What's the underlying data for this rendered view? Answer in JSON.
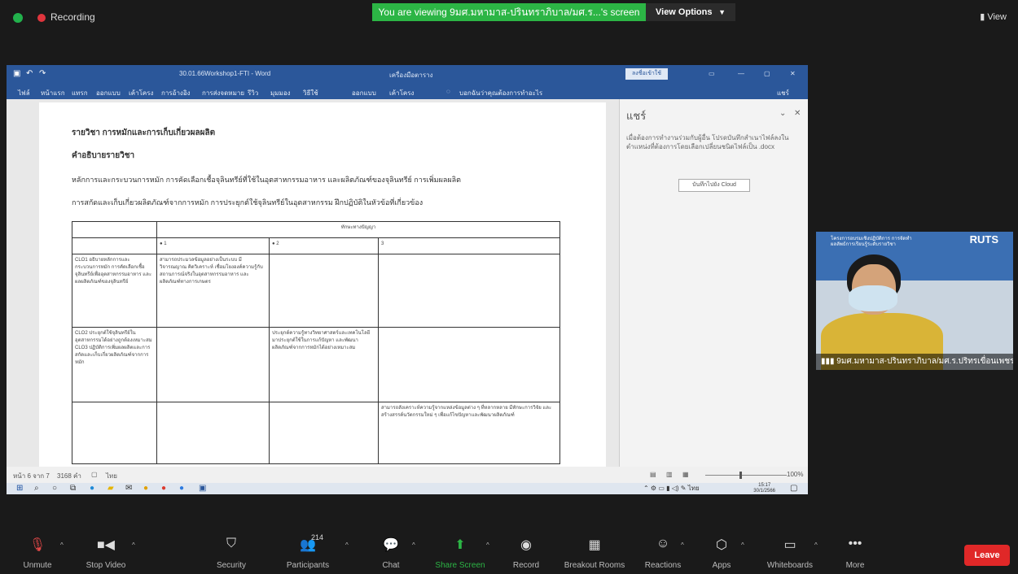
{
  "zoom": {
    "recording_label": "Recording",
    "viewing_banner": "You are viewing 9มศ.มหามาส-ปรินทราภิบาล/มศ.ร...'s screen",
    "view_options": "View Options",
    "view_label": "View",
    "leave_label": "Leave",
    "participant_count": "214",
    "toolbar": [
      {
        "label": "Unmute",
        "icon": "mic-muted-icon"
      },
      {
        "label": "Stop Video",
        "icon": "video-camera-icon"
      },
      {
        "label": "Security",
        "icon": "shield-icon"
      },
      {
        "label": "Participants",
        "icon": "participants-icon"
      },
      {
        "label": "Chat",
        "icon": "chat-icon"
      },
      {
        "label": "Share Screen",
        "icon": "share-screen-icon"
      },
      {
        "label": "Record",
        "icon": "record-icon"
      },
      {
        "label": "Breakout Rooms",
        "icon": "breakout-rooms-icon"
      },
      {
        "label": "Reactions",
        "icon": "reactions-icon"
      },
      {
        "label": "Apps",
        "icon": "apps-icon"
      },
      {
        "label": "Whiteboards",
        "icon": "whiteboard-icon"
      },
      {
        "label": "More",
        "icon": "more-icon"
      }
    ]
  },
  "word": {
    "title": "30.01.66Workshop1-FTI - Word",
    "signin": "ลงชื่อเข้าใช้",
    "ribbon_tabs": [
      "ไฟล์",
      "หน้าแรก",
      "แทรก",
      "ออกแบบ",
      "เค้าโครง",
      "การอ้างอิง",
      "การส่งจดหมาย",
      "รีวิว",
      "มุมมอง",
      "วิธีใช้",
      "ออกแบบ",
      "เค้าโครง"
    ],
    "tell_me": "บอกฉันว่าคุณต้องการทำอะไร",
    "share": "แชร์",
    "doc_lines": [
      "รายวิชา การหมักและการเก็บเกี่ยวผลผลิต",
      "คำอธิบายรายวิชา",
      "หลักการและกระบวนการหมัก การคัดเลือกเชื้อจุลินทรีย์ที่ใช้ในอุตสาหกรรมอาหาร และผลิตภัณฑ์ของจุลินทรีย์ การเพิ่มผลผลิต",
      "การสกัดและเก็บเกี่ยวผลิตภัณฑ์จากการหมัก การประยุกต์ใช้จุลินทรีย์ในอุตสาหกรรม ฝึกปฏิบัติในหัวข้อที่เกี่ยวข้อง"
    ],
    "table": {
      "header": "ทักษะทางปัญญา",
      "cols": [
        "1",
        "2",
        "3"
      ],
      "rows": [
        [
          "CLO1 อธิบายหลักการและกระบวนการหมัก การคัดเลือกเชื้อจุลินทรีย์เพื่ออุตสาหกรรมอาหาร และ ผลผลิตภัณฑ์ของจุลินทรีย์",
          "สามารถประมวลข้อมูลอย่างเป็นระบบ มีวิจารณญาณ คิดวิเคราะห์ เชื่อมโยงองค์ความรู้กับสถานการณ์จริงในอุตสาหกรรมอาหาร และผลิตภัณฑ์ทางการเกษตร",
          "",
          ""
        ],
        [
          "CLO2 ประยุกต์ใช้จุลินทรีย์ในอุตสาหกรรมได้อย่างถูกต้องเหมาะสม CLO3 ปฏิบัติการเพิ่มผลผลิตและการสกัดและเก็บเกี่ยวผลิตภัณฑ์จากการหมัก",
          "",
          "ประยุกต์ความรู้ทางวิทยาศาสตร์และเทคโนโลยีมาประยุกต์ใช้ในการแก้ปัญหา และพัฒนาผลิตภัณฑ์จากการหมักได้อย่างเหมาะสม",
          ""
        ],
        [
          "",
          "",
          "",
          "สามารถสังเคราะห์ความรู้จากแหล่งข้อมูลต่าง ๆ ที่หลากหลาย มีทักษะการวิจัย และสร้างสรรค์นวัตกรรมใหม่ ๆ เพื่อแก้ไขปัญหาและพัฒนาผลิตภัณฑ์"
        ]
      ]
    },
    "share_pane": {
      "title": "แชร์",
      "message": "เมื่อต้องการทำงานร่วมกับผู้อื่น โปรดบันทึกสำเนาไฟล์ลงในตำแหน่งที่ต้องการโดยเลือกเปลี่ยนชนิดไฟล์เป็น .docx",
      "button": "บันทึกไปยัง Cloud"
    },
    "status": {
      "page": "หน้า 6 จาก 7",
      "words": "3168 คำ",
      "lang": "ไทย",
      "zoom": "100%"
    },
    "clock_time": "15:17",
    "clock_date": "30/1/2566"
  },
  "video": {
    "name": "9มศ.มหามาส-ปรินทราภิบาล/มศ.ร.ปริทรเขื่อนเพชร...",
    "banner_text": "โครงการอบรมเชิงปฏิบัติการ การจัดทำผลลัพธ์การเรียนรู้ระดับรายวิชา",
    "logo": "RUTS"
  }
}
